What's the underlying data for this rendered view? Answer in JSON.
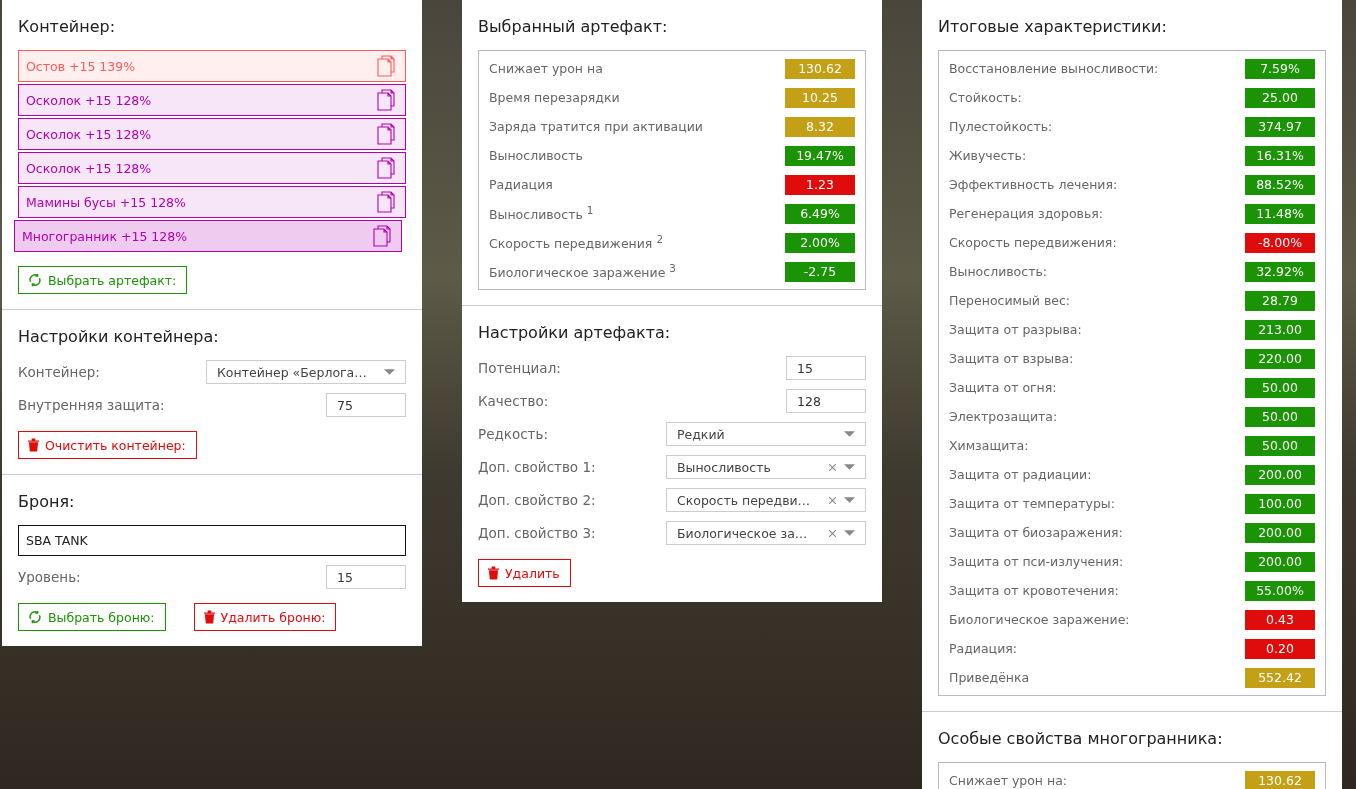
{
  "container": {
    "title": "Контейнер:",
    "items": [
      {
        "label": "Остов +15 139%",
        "color": "#ff5a5a",
        "selected": false
      },
      {
        "label": "Осколок +15 128%",
        "color": "#b000b0",
        "selected": false
      },
      {
        "label": "Осколок +15 128%",
        "color": "#b000b0",
        "selected": false
      },
      {
        "label": "Осколок +15 128%",
        "color": "#b000b0",
        "selected": false
      },
      {
        "label": "Мамины бусы +15 128%",
        "color": "#b000b0",
        "selected": false
      },
      {
        "label": "Многогранник +15 128%",
        "color": "#b000b0",
        "selected": true
      }
    ],
    "buttons": [
      {
        "kind": "pick",
        "label": "Выбрать артефакт:"
      }
    ]
  },
  "container_settings": {
    "title": "Настройки контейнера:",
    "fields": [
      {
        "kind": "select",
        "label": "Контейнер:",
        "value": "Контейнер «Берлога…",
        "clearable": false
      },
      {
        "kind": "input",
        "label": "Внутренняя защита:",
        "value": "75"
      }
    ],
    "buttons": [
      {
        "kind": "delete",
        "label": "Очистить контейнер:"
      }
    ]
  },
  "armor": {
    "title": "Броня:",
    "name": "SBA TANK",
    "fields": [
      {
        "kind": "input",
        "label": "Уровень:",
        "value": "15"
      }
    ],
    "buttons": [
      {
        "kind": "pick",
        "label": "Выбрать броню:"
      },
      {
        "kind": "delete",
        "label": "Удалить броню:"
      }
    ]
  },
  "artifact": {
    "title": "Выбранный артефакт:",
    "stats": [
      {
        "label": "Снижает урон на",
        "value": "130.62",
        "color": "#c4a016"
      },
      {
        "label": "Время перезарядки",
        "value": "10.25",
        "color": "#c4a016"
      },
      {
        "label": "Заряда тратится при активации",
        "value": "8.32",
        "color": "#c4a016"
      },
      {
        "label": "Выносливость",
        "value": "19.47%",
        "color": "#1a9304"
      },
      {
        "label": "Радиация",
        "value": "1.23",
        "color": "#e00b0b"
      },
      {
        "label": "Выносливость $^{1}$",
        "value": "6.49%",
        "color": "#1a9304"
      },
      {
        "label": "Скорость передвижения $^{2}$",
        "value": "2.00%",
        "color": "#1a9304"
      },
      {
        "label": "Биологическое заражение $^{3}$",
        "value": "-2.75",
        "color": "#1a9304"
      }
    ]
  },
  "artifact_settings": {
    "title": "Настройки артефакта:",
    "fields": [
      {
        "kind": "input",
        "label": "Потенциал:",
        "value": "15"
      },
      {
        "kind": "input",
        "label": "Качество:",
        "value": "128"
      },
      {
        "kind": "select",
        "label": "Редкость:",
        "value": "Редкий",
        "clearable": false
      },
      {
        "kind": "select",
        "label": "Доп. свойство 1:",
        "value": "Выносливость",
        "clearable": true
      },
      {
        "kind": "select",
        "label": "Доп. свойство 2:",
        "value": "Скорость передви…",
        "clearable": true
      },
      {
        "kind": "select",
        "label": "Доп. свойство 3:",
        "value": "Биологическое за…",
        "clearable": true
      }
    ],
    "buttons": [
      {
        "kind": "delete",
        "label": "Удалить"
      }
    ]
  },
  "totals": {
    "title": "Итоговые характеристики:",
    "stats": [
      {
        "label": "Восстановление выносливости:",
        "value": "7.59%",
        "color": "#1a9304"
      },
      {
        "label": "Стойкость:",
        "value": "25.00",
        "color": "#1a9304"
      },
      {
        "label": "Пулестойкость:",
        "value": "374.97",
        "color": "#1a9304"
      },
      {
        "label": "Живучесть:",
        "value": "16.31%",
        "color": "#1a9304"
      },
      {
        "label": "Эффективность лечения:",
        "value": "88.52%",
        "color": "#1a9304"
      },
      {
        "label": "Регенерация здоровья:",
        "value": "11.48%",
        "color": "#1a9304"
      },
      {
        "label": "Скорость передвижения:",
        "value": "-8.00%",
        "color": "#e00b0b"
      },
      {
        "label": "Выносливость:",
        "value": "32.92%",
        "color": "#1a9304"
      },
      {
        "label": "Переносимый вес:",
        "value": "28.79",
        "color": "#1a9304"
      },
      {
        "label": "Защита от разрыва:",
        "value": "213.00",
        "color": "#1a9304"
      },
      {
        "label": "Защита от взрыва:",
        "value": "220.00",
        "color": "#1a9304"
      },
      {
        "label": "Защита от огня:",
        "value": "50.00",
        "color": "#1a9304"
      },
      {
        "label": "Электрозащита:",
        "value": "50.00",
        "color": "#1a9304"
      },
      {
        "label": "Химзащита:",
        "value": "50.00",
        "color": "#1a9304"
      },
      {
        "label": "Защита от радиации:",
        "value": "200.00",
        "color": "#1a9304"
      },
      {
        "label": "Защита от температуры:",
        "value": "100.00",
        "color": "#1a9304"
      },
      {
        "label": "Защита от биозаражения:",
        "value": "200.00",
        "color": "#1a9304"
      },
      {
        "label": "Защита от пси-излучения:",
        "value": "200.00",
        "color": "#1a9304"
      },
      {
        "label": "Защита от кровотечения:",
        "value": "55.00%",
        "color": "#1a9304"
      },
      {
        "label": "Биологическое заражение:",
        "value": "0.43",
        "color": "#e00b0b"
      },
      {
        "label": "Радиация:",
        "value": "0.20",
        "color": "#e00b0b"
      },
      {
        "label": "Приведёнка",
        "value": "552.42",
        "color": "#c4a016"
      }
    ]
  },
  "special": {
    "title": "Особые свойства многогранника:",
    "stats": [
      {
        "label": "Снижает урон на:",
        "value": "130.62",
        "color": "#c4a016"
      }
    ]
  }
}
